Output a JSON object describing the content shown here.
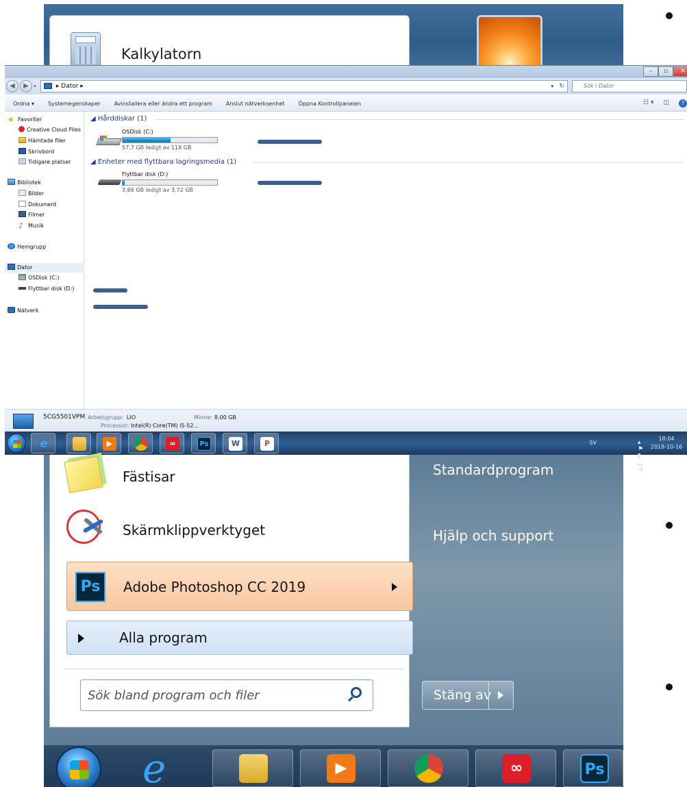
{
  "top_start_menu": {
    "calculator_label": "Kalkylatorn"
  },
  "explorer": {
    "address_path": [
      "Dator"
    ],
    "search_placeholder": "Sök i Dator",
    "toolbar": {
      "organize": "Ordna ▾",
      "system_properties": "Systemegenskaper",
      "uninstall": "Avinstallera eller ändra ett program",
      "map_network_drive": "Anslut nätverksenhet",
      "open_control_panel": "Öppna Kontrollpanelen"
    },
    "nav_pane": {
      "favorites": "Favoriter",
      "creative_cloud": "Creative Cloud Files",
      "downloads": "Hämtade filer",
      "desktop": "Skrivbord",
      "recent": "Tidigare platser",
      "libraries": "Bibliotek",
      "pictures": "Bilder",
      "documents": "Dokument",
      "videos": "Filmer",
      "music": "Musik",
      "homegroup": "Hemgrupp",
      "computer": "Dator",
      "drive_c": "OSDisk (C:)",
      "drive_d": "Flyttbar disk (D:)",
      "network": "Nätverk"
    },
    "content": {
      "hard_drives_header": "Hårddiskar (1)",
      "removable_header": "Enheter med flyttbara lagringsmedia (1)",
      "drive_c": {
        "name": "OSDisk (C:)",
        "free": "57,7 GB ledigt av 118 GB",
        "used_fraction": 0.51
      },
      "drive_d": {
        "name": "Flyttbar disk (D:)",
        "free": "3,66 GB ledigt av 3,72 GB",
        "used_fraction": 0.02
      }
    },
    "details": {
      "computer_name": "5CG5501VPM",
      "workgroup_label": "Arbetsgrupp:",
      "workgroup_value": "LIO",
      "memory_label": "Minne:",
      "memory_value": "8,00 GB",
      "processor_label": "Processor:",
      "processor_value": "Intel(R) Core(TM) i5-52..."
    }
  },
  "taskbar": {
    "language": "SV",
    "time": "18:04",
    "date": "2018-10-16",
    "apps": [
      "internet-explorer",
      "file-explorer",
      "media-player",
      "chrome",
      "creative-cloud",
      "photoshop",
      "word",
      "powerpoint"
    ]
  },
  "start_menu": {
    "sticky_notes": "Fästisar",
    "snipping_tool": "Skärmklippverktyget",
    "photoshop": "Adobe Photoshop CC 2019",
    "all_programs": "Alla program",
    "search_placeholder": "Sök bland program och filer",
    "default_programs": "Standardprogram",
    "help_support": "Hjälp och support",
    "shutdown": "Stäng av"
  },
  "colors": {
    "annotation_arrow": "#3b5e8c",
    "progress_fill": "#1893d6",
    "photoshop_highlight": "#f8c7a0",
    "taskbar": "#1e3f66"
  }
}
